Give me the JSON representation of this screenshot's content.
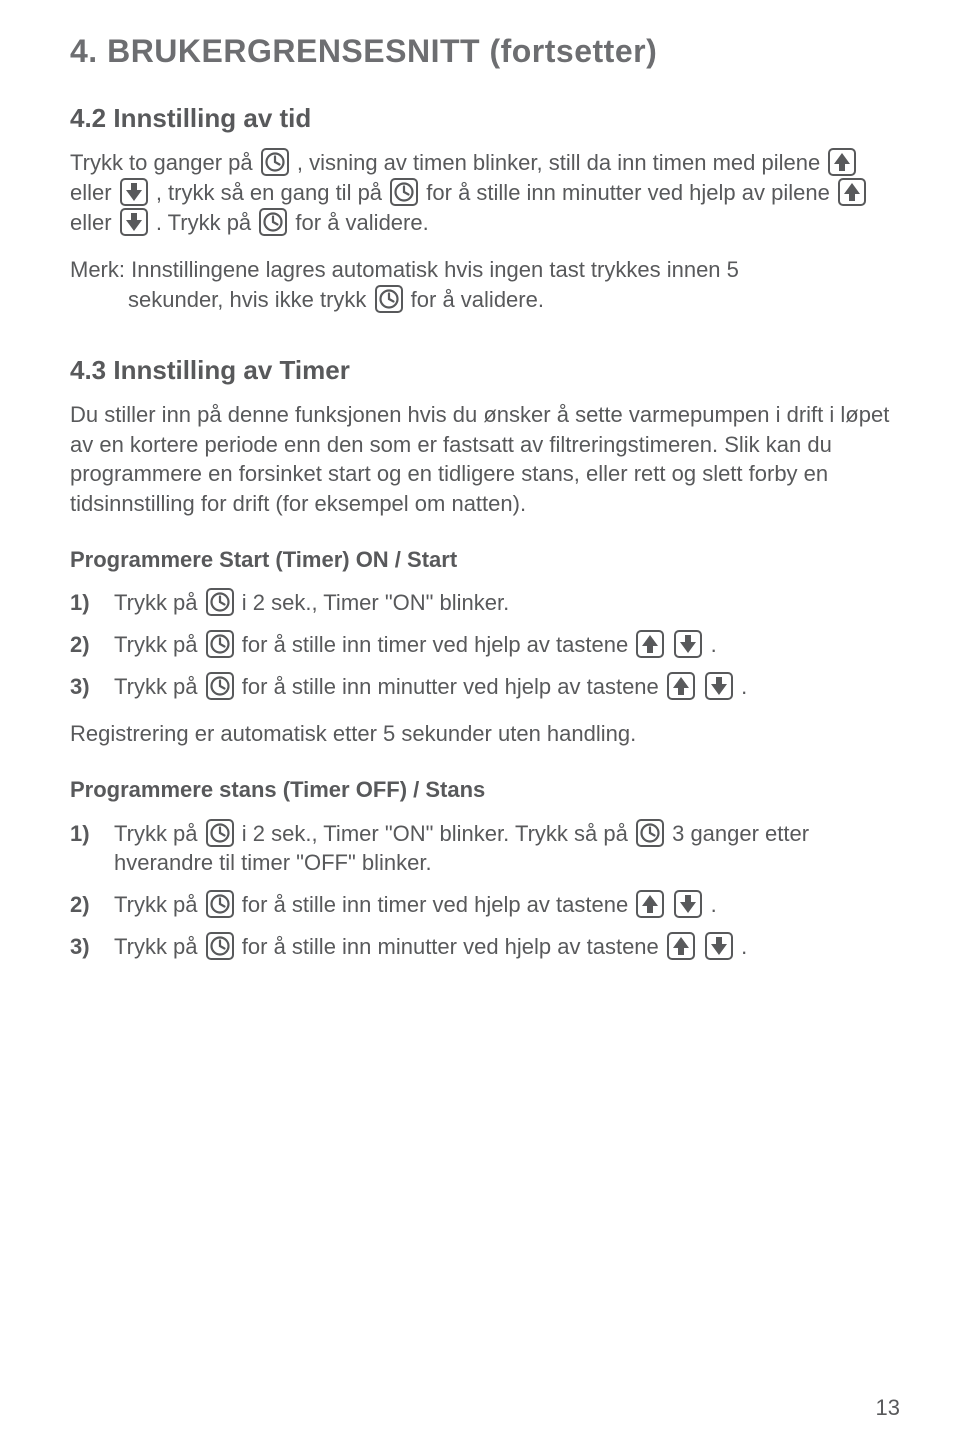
{
  "page_title": "4. BRUKERGRENSESNITT (fortsetter)",
  "s42": {
    "heading": "4.2 Innstilling av tid",
    "p1a": "Trykk to ganger på ",
    "p1b": ", visning av timen blinker, still da inn timen med pilene ",
    "p1c": " eller ",
    "p1d": " , trykk så en gang til på ",
    "p1e": " for å stille inn minutter ved hjelp av pilene ",
    "p1f": " eller ",
    "p1g": ". Trykk på ",
    "p1h": " for å validere.",
    "note1": "Merk: Innstillingene lagres automatisk hvis ingen tast trykkes innen 5",
    "note2a": "sekunder, hvis ikke trykk ",
    "note2b": " for å validere."
  },
  "s43": {
    "heading": "4.3 Innstilling av Timer",
    "intro": "Du stiller inn på denne funksjonen hvis du ønsker å sette varmepumpen i drift i løpet av en kortere periode enn den som er fastsatt av filtreringstimeren. Slik kan du programmere en forsinket start og en tidligere stans, eller rett og slett forby en tidsinnstilling for drift (for eksempel om natten).",
    "on_heading": "Programmere Start (Timer) ON / Start",
    "on_step1_num": "1)",
    "on_step1a": "Trykk på ",
    "on_step1b": " i 2 sek., Timer \"ON\" blinker.",
    "on_step2_num": "2)",
    "on_step2a": "Trykk på ",
    "on_step2b": " for å stille inn timer ved hjelp av tastene ",
    "on_step2c": ".",
    "on_step3_num": "3)",
    "on_step3a": "Trykk på  ",
    "on_step3b": " for å stille inn minutter ved hjelp av tastene ",
    "on_step3c": ".",
    "on_after": "Registrering er automatisk etter 5 sekunder uten handling.",
    "off_heading": "Programmere stans (Timer OFF) / Stans",
    "off_step1_num": "1)",
    "off_step1a": "Trykk på ",
    "off_step1b": " i 2 sek., Timer \"ON\" blinker. Trykk så på ",
    "off_step1c": " 3 ganger etter",
    "off_step1_cont": "hverandre til timer \"OFF\" blinker.",
    "off_step2_num": "2)",
    "off_step2a": "Trykk på ",
    "off_step2b": " for å stille inn timer ved hjelp av tastene ",
    "off_step2c": ".",
    "off_step3_num": "3)",
    "off_step3a": "Trykk på  ",
    "off_step3b": " for å stille inn minutter ved hjelp av tastene ",
    "off_step3c": "."
  },
  "page_number": "13"
}
